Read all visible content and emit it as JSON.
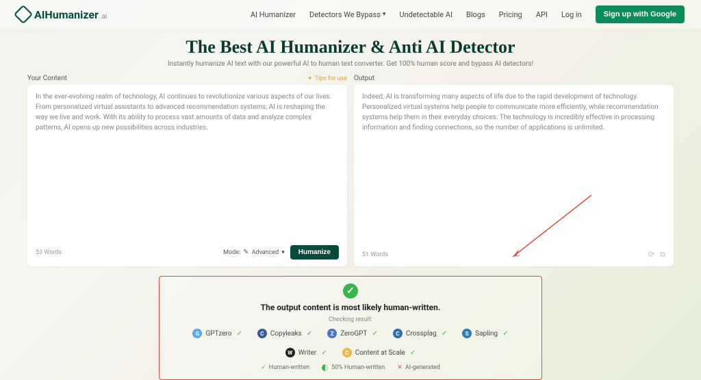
{
  "brand": {
    "name": "AIHumanizer",
    "suffix": ".ai"
  },
  "nav": {
    "items": [
      "AI Humanizer",
      "Detectors We Bypass",
      "Undetectable AI",
      "Blogs",
      "Pricing",
      "API",
      "Log in"
    ],
    "signup": "Sign up with Google"
  },
  "hero": {
    "title": "The Best AI Humanizer & Anti AI Detector",
    "subtitle": "Instantly humanize AI text with our powerful AI to human text converter. Get 100% human score and bypass AI detectors!"
  },
  "input": {
    "label": "Your Content",
    "tips": "Tips for use",
    "text": "In the ever-evolving realm of technology, AI continues to revolutionize various aspects of our lives. From personalized virtual assistants to advanced recommendation systems, AI is reshaping the way we live and work. With its ability to process vast amounts of data and analyze complex patterns, AI opens up new possibilities across industries.",
    "word_count": "53 Words",
    "mode_label": "Mode:",
    "mode_value": "Advanced",
    "button": "Humanize"
  },
  "output": {
    "label": "Output",
    "text": "Indeed, AI is transforming many aspects of life due to the rapid development of technology. Personalized virtual systems help people to communicate more efficiently, while recommendation systems help them in their everyday choices. The technology is incredibly effective in processing information and finding connections, so the number of applications is unlimited.",
    "word_count": "51 Words"
  },
  "result": {
    "title": "The output content is most likely human-written.",
    "subtitle": "Checking result:",
    "detectors": [
      {
        "name": "GPTzero",
        "color": "#5aa9e6"
      },
      {
        "name": "Copyleaks",
        "color": "#3b5998"
      },
      {
        "name": "ZeroGPT",
        "color": "#4a76c9"
      },
      {
        "name": "Crossplag",
        "color": "#2f6fb0"
      },
      {
        "name": "Sapling",
        "color": "#2d7ab5"
      },
      {
        "name": "Writer",
        "color": "#222222"
      },
      {
        "name": "Content at Scale",
        "color": "#e8b84a"
      }
    ],
    "legend": {
      "human": "Human-written",
      "half": "50% Human-written",
      "ai": "AI-generated"
    }
  }
}
